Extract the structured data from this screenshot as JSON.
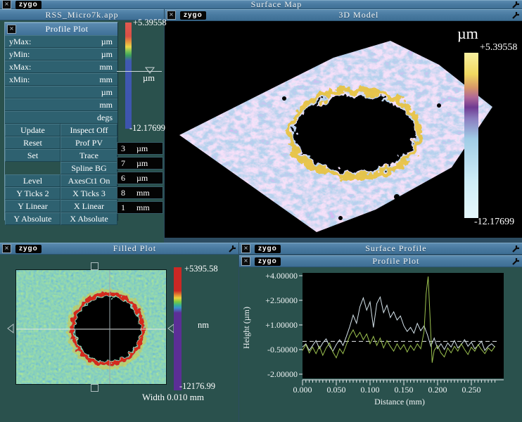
{
  "app": {
    "titlebar": {
      "title": "Surface Map",
      "logo": "zygo"
    },
    "window_title": "RSS_Micro7k.app"
  },
  "profile_controls": {
    "title": "Profile Plot",
    "fields": [
      {
        "label": "yMax:",
        "value": "",
        "unit": "µm"
      },
      {
        "label": "yMin:",
        "value": "",
        "unit": "µm"
      },
      {
        "label": "xMax:",
        "value": "",
        "unit": "mm"
      },
      {
        "label": "xMin:",
        "value": "",
        "unit": "mm"
      },
      {
        "label": "",
        "value": "",
        "unit": "µm"
      },
      {
        "label": "",
        "value": "",
        "unit": "mm"
      },
      {
        "label": "",
        "value": "",
        "unit": "degs"
      }
    ],
    "buttons": [
      [
        "Update",
        "Inspect Off"
      ],
      [
        "Reset",
        "Prof PV"
      ],
      [
        "Set",
        "Trace"
      ],
      [
        "",
        "Spline BG"
      ],
      [
        "Level",
        "AxesCt1 On"
      ],
      [
        "Y Ticks 2",
        "X Ticks 3"
      ],
      [
        "Y Linear",
        "X Linear"
      ],
      [
        "Y Absolute",
        "X Absolute"
      ]
    ],
    "scale": {
      "max": "+5.39558",
      "unit": "µm",
      "min": "-12.17699"
    },
    "value_fields": [
      {
        "value": "3",
        "unit": "µm"
      },
      {
        "value": "7",
        "unit": "µm"
      },
      {
        "value": "6",
        "unit": "µm"
      },
      {
        "value": "8",
        "unit": "mm"
      },
      {
        "value": "1",
        "unit": "mm"
      }
    ]
  },
  "model_3d": {
    "logo": "zygo",
    "title": "3D Model",
    "scale": {
      "unit": "µm",
      "max": "+5.39558",
      "min": "-12.17699"
    }
  },
  "filled_plot": {
    "logo": "zygo",
    "title": "Filled Plot",
    "scale": {
      "max": "+5395.58",
      "unit": "nm",
      "min": "-12176.99"
    },
    "width_label": "Width 0.010 mm"
  },
  "surface_profile": {
    "logo": "zygo",
    "title": "Surface Profile"
  },
  "profile_plot_window": {
    "logo": "zygo",
    "title": "Profile Plot"
  },
  "chart_data": {
    "type": "line",
    "title": "Profile Plot",
    "xlabel": "Distance (mm)",
    "ylabel": "Height (µm)",
    "xlim": [
      0,
      0.285
    ],
    "ylim": [
      -2.0,
      4.0
    ],
    "x_ticks": [
      0.0,
      0.05,
      0.1,
      0.15,
      0.2,
      0.25
    ],
    "x_tick_labels": [
      "0.000",
      "0.050",
      "0.100",
      "0.150",
      "0.200",
      "0.250"
    ],
    "y_ticks": [
      4.0,
      2.5,
      1.0,
      -0.5,
      -2.0
    ],
    "y_tick_labels": [
      "+4.00000",
      "+2.50000",
      "+1.00000",
      "-0.50000",
      "-2.00000"
    ],
    "grid": false,
    "background": "#000000",
    "reference_line": {
      "style": "dashed",
      "color": "#e8ecee",
      "value": 0.0
    },
    "series": [
      {
        "name": "profile-trace-white",
        "color": "#d4e2ea",
        "points": [
          [
            0.0,
            -0.35
          ],
          [
            0.005,
            -0.15
          ],
          [
            0.01,
            -0.55
          ],
          [
            0.015,
            -0.25
          ],
          [
            0.02,
            0.05
          ],
          [
            0.025,
            -0.45
          ],
          [
            0.03,
            -0.1
          ],
          [
            0.035,
            0.15
          ],
          [
            0.04,
            -0.3
          ],
          [
            0.045,
            -0.6
          ],
          [
            0.05,
            -0.2
          ],
          [
            0.055,
            0.1
          ],
          [
            0.06,
            -0.25
          ],
          [
            0.065,
            0.3
          ],
          [
            0.07,
            0.9
          ],
          [
            0.075,
            1.6
          ],
          [
            0.08,
            1.1
          ],
          [
            0.085,
            2.1
          ],
          [
            0.09,
            2.65
          ],
          [
            0.095,
            1.9
          ],
          [
            0.1,
            2.4
          ],
          [
            0.105,
            0.85
          ],
          [
            0.11,
            2.3
          ],
          [
            0.115,
            2.7
          ],
          [
            0.12,
            1.75
          ],
          [
            0.125,
            2.2
          ],
          [
            0.13,
            1.45
          ],
          [
            0.135,
            1.8
          ],
          [
            0.14,
            1.3
          ],
          [
            0.145,
            1.55
          ],
          [
            0.15,
            0.95
          ],
          [
            0.155,
            0.6
          ],
          [
            0.16,
            0.85
          ],
          [
            0.165,
            0.5
          ],
          [
            0.17,
            1.1
          ],
          [
            0.175,
            0.65
          ],
          [
            0.18,
            0.95
          ],
          [
            0.185,
            0.4
          ],
          [
            0.19,
            -0.3
          ],
          [
            0.195,
            0.2
          ],
          [
            0.2,
            -0.45
          ],
          [
            0.205,
            -0.15
          ],
          [
            0.21,
            -0.5
          ],
          [
            0.215,
            -0.1
          ],
          [
            0.22,
            -0.35
          ],
          [
            0.225,
            0.05
          ],
          [
            0.23,
            -0.4
          ],
          [
            0.235,
            -0.2
          ],
          [
            0.24,
            0.1
          ],
          [
            0.245,
            -0.3
          ],
          [
            0.25,
            -0.05
          ],
          [
            0.255,
            -0.45
          ],
          [
            0.26,
            -0.25
          ],
          [
            0.265,
            0.0
          ],
          [
            0.27,
            -0.55
          ],
          [
            0.275,
            -0.3
          ],
          [
            0.28,
            -0.15
          ],
          [
            0.285,
            -0.35
          ]
        ]
      },
      {
        "name": "profile-trace-green",
        "color": "#9cc24f",
        "points": [
          [
            0.0,
            -0.55
          ],
          [
            0.005,
            -0.2
          ],
          [
            0.01,
            -0.7
          ],
          [
            0.015,
            -0.35
          ],
          [
            0.02,
            -0.75
          ],
          [
            0.025,
            -0.3
          ],
          [
            0.03,
            -0.85
          ],
          [
            0.035,
            -0.4
          ],
          [
            0.04,
            -0.1
          ],
          [
            0.045,
            -0.65
          ],
          [
            0.05,
            -1.0
          ],
          [
            0.055,
            -0.45
          ],
          [
            0.06,
            -0.75
          ],
          [
            0.065,
            -0.2
          ],
          [
            0.07,
            0.35
          ],
          [
            0.075,
            0.7
          ],
          [
            0.08,
            0.25
          ],
          [
            0.085,
            0.55
          ],
          [
            0.09,
            0.1
          ],
          [
            0.095,
            0.45
          ],
          [
            0.1,
            -0.15
          ],
          [
            0.105,
            0.3
          ],
          [
            0.11,
            -0.25
          ],
          [
            0.115,
            0.2
          ],
          [
            0.12,
            -0.4
          ],
          [
            0.125,
            0.05
          ],
          [
            0.13,
            -0.3
          ],
          [
            0.135,
            -0.6
          ],
          [
            0.14,
            -0.15
          ],
          [
            0.145,
            -0.5
          ],
          [
            0.15,
            -0.2
          ],
          [
            0.155,
            -0.65
          ],
          [
            0.16,
            -0.25
          ],
          [
            0.165,
            -0.55
          ],
          [
            0.17,
            -0.15
          ],
          [
            0.175,
            -0.45
          ],
          [
            0.18,
            0.6
          ],
          [
            0.183,
            2.9
          ],
          [
            0.186,
            3.95
          ],
          [
            0.189,
            1.4
          ],
          [
            0.192,
            -1.3
          ],
          [
            0.195,
            -0.55
          ],
          [
            0.2,
            -0.25
          ],
          [
            0.205,
            -0.7
          ],
          [
            0.21,
            -0.95
          ],
          [
            0.215,
            -0.4
          ],
          [
            0.22,
            -0.7
          ],
          [
            0.225,
            -0.3
          ],
          [
            0.23,
            -0.6
          ],
          [
            0.235,
            -0.15
          ],
          [
            0.24,
            -0.5
          ],
          [
            0.245,
            -0.8
          ],
          [
            0.25,
            -0.35
          ],
          [
            0.255,
            -0.6
          ],
          [
            0.26,
            -0.2
          ],
          [
            0.265,
            -0.5
          ],
          [
            0.27,
            -0.75
          ],
          [
            0.275,
            -0.4
          ],
          [
            0.28,
            -0.6
          ],
          [
            0.285,
            -0.3
          ]
        ]
      }
    ]
  }
}
